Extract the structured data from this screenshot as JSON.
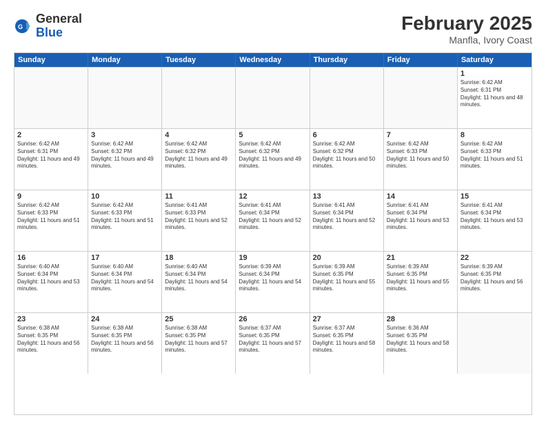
{
  "logo": {
    "general": "General",
    "blue": "Blue"
  },
  "title": {
    "month": "February 2025",
    "location": "Manfla, Ivory Coast"
  },
  "header_days": [
    "Sunday",
    "Monday",
    "Tuesday",
    "Wednesday",
    "Thursday",
    "Friday",
    "Saturday"
  ],
  "weeks": [
    [
      {
        "day": "",
        "text": "",
        "empty": true
      },
      {
        "day": "",
        "text": "",
        "empty": true
      },
      {
        "day": "",
        "text": "",
        "empty": true
      },
      {
        "day": "",
        "text": "",
        "empty": true
      },
      {
        "day": "",
        "text": "",
        "empty": true
      },
      {
        "day": "",
        "text": "",
        "empty": true
      },
      {
        "day": "1",
        "text": "Sunrise: 6:42 AM\nSunset: 6:31 PM\nDaylight: 11 hours and 48 minutes.",
        "empty": false
      }
    ],
    [
      {
        "day": "2",
        "text": "Sunrise: 6:42 AM\nSunset: 6:31 PM\nDaylight: 11 hours and 49 minutes.",
        "empty": false
      },
      {
        "day": "3",
        "text": "Sunrise: 6:42 AM\nSunset: 6:32 PM\nDaylight: 11 hours and 49 minutes.",
        "empty": false
      },
      {
        "day": "4",
        "text": "Sunrise: 6:42 AM\nSunset: 6:32 PM\nDaylight: 11 hours and 49 minutes.",
        "empty": false
      },
      {
        "day": "5",
        "text": "Sunrise: 6:42 AM\nSunset: 6:32 PM\nDaylight: 11 hours and 49 minutes.",
        "empty": false
      },
      {
        "day": "6",
        "text": "Sunrise: 6:42 AM\nSunset: 6:32 PM\nDaylight: 11 hours and 50 minutes.",
        "empty": false
      },
      {
        "day": "7",
        "text": "Sunrise: 6:42 AM\nSunset: 6:33 PM\nDaylight: 11 hours and 50 minutes.",
        "empty": false
      },
      {
        "day": "8",
        "text": "Sunrise: 6:42 AM\nSunset: 6:33 PM\nDaylight: 11 hours and 51 minutes.",
        "empty": false
      }
    ],
    [
      {
        "day": "9",
        "text": "Sunrise: 6:42 AM\nSunset: 6:33 PM\nDaylight: 11 hours and 51 minutes.",
        "empty": false
      },
      {
        "day": "10",
        "text": "Sunrise: 6:42 AM\nSunset: 6:33 PM\nDaylight: 11 hours and 51 minutes.",
        "empty": false
      },
      {
        "day": "11",
        "text": "Sunrise: 6:41 AM\nSunset: 6:33 PM\nDaylight: 11 hours and 52 minutes.",
        "empty": false
      },
      {
        "day": "12",
        "text": "Sunrise: 6:41 AM\nSunset: 6:34 PM\nDaylight: 11 hours and 52 minutes.",
        "empty": false
      },
      {
        "day": "13",
        "text": "Sunrise: 6:41 AM\nSunset: 6:34 PM\nDaylight: 11 hours and 52 minutes.",
        "empty": false
      },
      {
        "day": "14",
        "text": "Sunrise: 6:41 AM\nSunset: 6:34 PM\nDaylight: 11 hours and 53 minutes.",
        "empty": false
      },
      {
        "day": "15",
        "text": "Sunrise: 6:41 AM\nSunset: 6:34 PM\nDaylight: 11 hours and 53 minutes.",
        "empty": false
      }
    ],
    [
      {
        "day": "16",
        "text": "Sunrise: 6:40 AM\nSunset: 6:34 PM\nDaylight: 11 hours and 53 minutes.",
        "empty": false
      },
      {
        "day": "17",
        "text": "Sunrise: 6:40 AM\nSunset: 6:34 PM\nDaylight: 11 hours and 54 minutes.",
        "empty": false
      },
      {
        "day": "18",
        "text": "Sunrise: 6:40 AM\nSunset: 6:34 PM\nDaylight: 11 hours and 54 minutes.",
        "empty": false
      },
      {
        "day": "19",
        "text": "Sunrise: 6:39 AM\nSunset: 6:34 PM\nDaylight: 11 hours and 54 minutes.",
        "empty": false
      },
      {
        "day": "20",
        "text": "Sunrise: 6:39 AM\nSunset: 6:35 PM\nDaylight: 11 hours and 55 minutes.",
        "empty": false
      },
      {
        "day": "21",
        "text": "Sunrise: 6:39 AM\nSunset: 6:35 PM\nDaylight: 11 hours and 55 minutes.",
        "empty": false
      },
      {
        "day": "22",
        "text": "Sunrise: 6:39 AM\nSunset: 6:35 PM\nDaylight: 11 hours and 56 minutes.",
        "empty": false
      }
    ],
    [
      {
        "day": "23",
        "text": "Sunrise: 6:38 AM\nSunset: 6:35 PM\nDaylight: 11 hours and 56 minutes.",
        "empty": false
      },
      {
        "day": "24",
        "text": "Sunrise: 6:38 AM\nSunset: 6:35 PM\nDaylight: 11 hours and 56 minutes.",
        "empty": false
      },
      {
        "day": "25",
        "text": "Sunrise: 6:38 AM\nSunset: 6:35 PM\nDaylight: 11 hours and 57 minutes.",
        "empty": false
      },
      {
        "day": "26",
        "text": "Sunrise: 6:37 AM\nSunset: 6:35 PM\nDaylight: 11 hours and 57 minutes.",
        "empty": false
      },
      {
        "day": "27",
        "text": "Sunrise: 6:37 AM\nSunset: 6:35 PM\nDaylight: 11 hours and 58 minutes.",
        "empty": false
      },
      {
        "day": "28",
        "text": "Sunrise: 6:36 AM\nSunset: 6:35 PM\nDaylight: 11 hours and 58 minutes.",
        "empty": false
      },
      {
        "day": "",
        "text": "",
        "empty": true
      }
    ]
  ]
}
